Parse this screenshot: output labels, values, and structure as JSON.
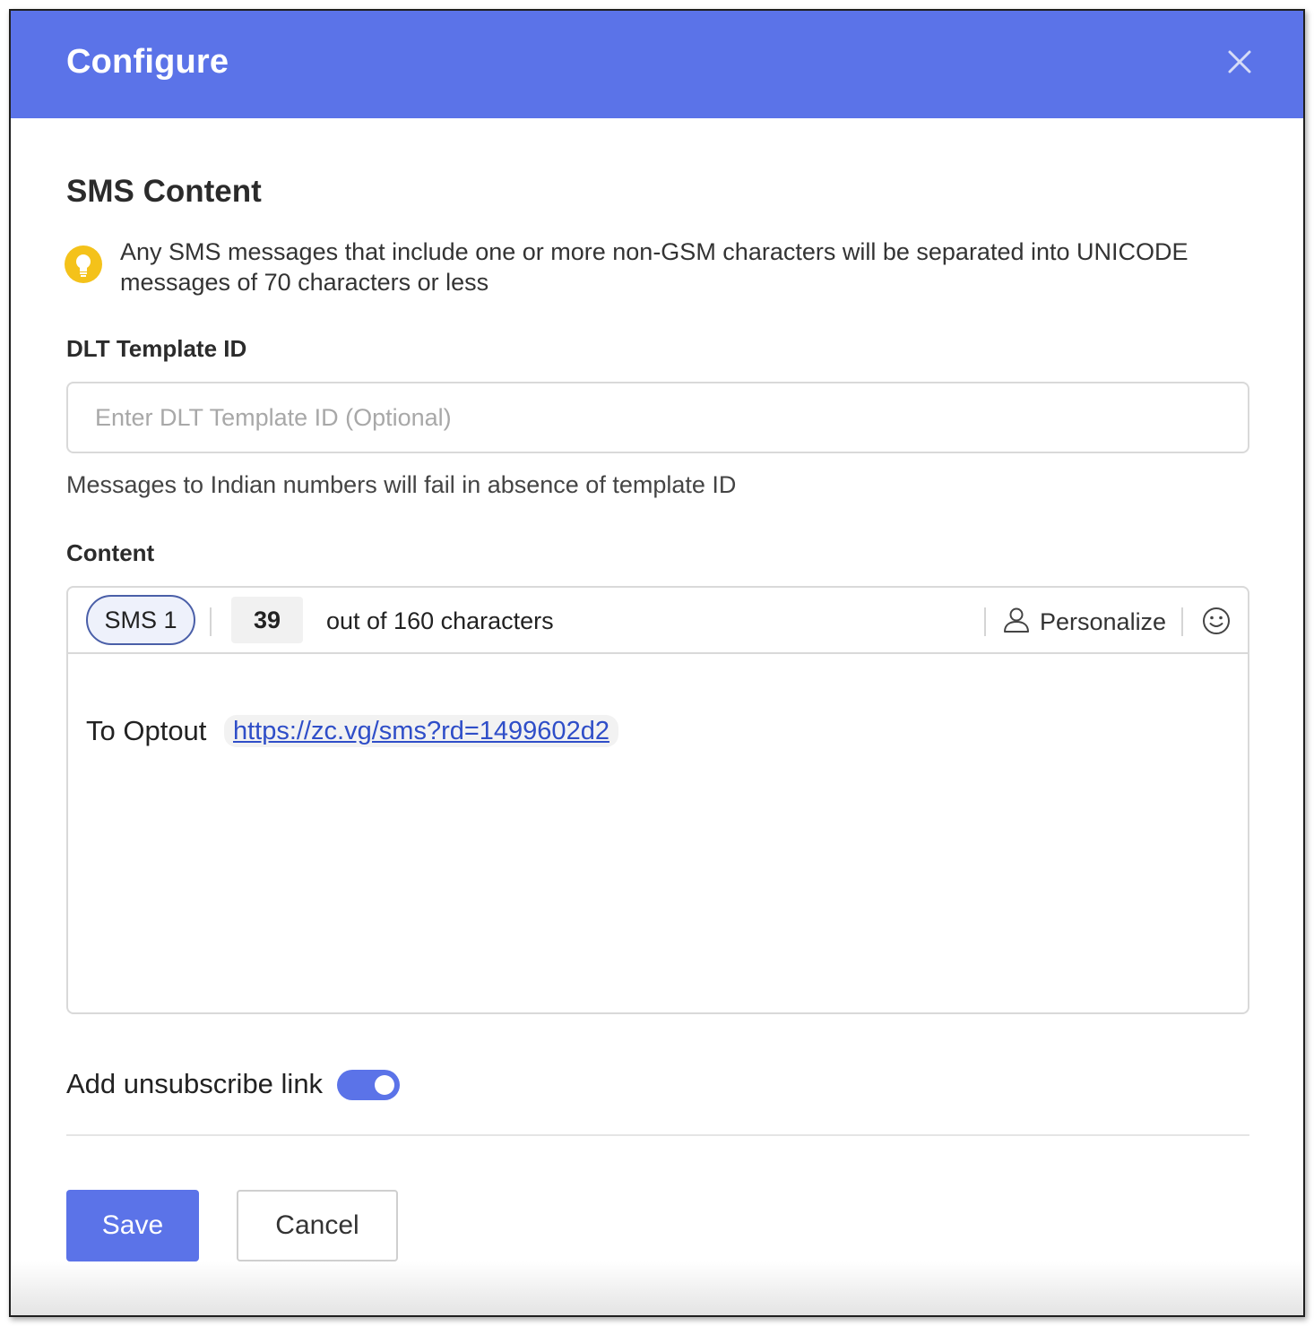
{
  "dialog": {
    "title": "Configure",
    "close_icon": "close-icon",
    "accent_color": "#5b73e8"
  },
  "sms_content": {
    "section_title": "SMS Content",
    "info_icon": "lightbulb-icon",
    "info_text": "Any SMS messages that include one or more non-GSM characters will be separated into UNICODE messages of 70 characters or less"
  },
  "dlt": {
    "label": "DLT Template ID",
    "value": "",
    "placeholder": "Enter DLT Template ID (Optional)",
    "hint": "Messages to Indian numbers will fail in absence of template ID"
  },
  "content": {
    "label": "Content",
    "toolbar": {
      "sms_tab": "SMS 1",
      "char_count": "39",
      "char_limit_text": "out of 160 characters",
      "personalize_icon": "user-icon",
      "personalize_label": "Personalize",
      "emoji_icon": "smiley-icon"
    },
    "body": {
      "text": "To Optout",
      "link": "https://zc.vg/sms?rd=1499602d2"
    }
  },
  "unsubscribe": {
    "label": "Add unsubscribe link",
    "enabled": true
  },
  "actions": {
    "save_label": "Save",
    "cancel_label": "Cancel"
  }
}
